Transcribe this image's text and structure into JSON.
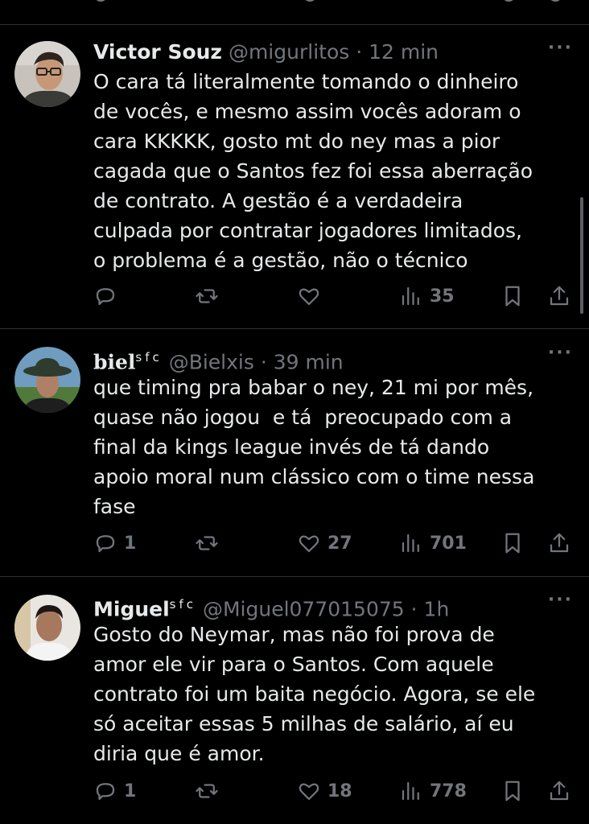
{
  "tweets": [
    {
      "name": "Victor Souz",
      "name_suffix": "",
      "handle": "@migurlitos",
      "dot": "·",
      "time": "12 min",
      "more": "···",
      "text": "O cara tá literalmente tomando o dinheiro\nde vocês, e mesmo assim vocês adoram o\ncara KKKKK, gosto mt do ney mas a pior\ncagada que o Santos fez foi essa aberração\nde contrato. A gestão é a verdadeira\nculpada por contratar jogadores limitados,\no problema é a gestão, não o técnico",
      "replies": "",
      "retweets": "",
      "likes": "",
      "views": "35"
    },
    {
      "name": "biel",
      "name_suffix": "sfc",
      "handle": "@Bielxis",
      "dot": "·",
      "time": "39 min",
      "more": "···",
      "text": "que timing pra babar o ney, 21 mi por mês,\nquase não jogou  e tá  preocupado com a\nfinal da kings league invés de tá dando\napoio moral num clássico com o time nessa\nfase",
      "replies": "1",
      "retweets": "",
      "likes": "27",
      "views": "701"
    },
    {
      "name": "Miguel",
      "name_suffix": "sfc",
      "handle": "@Miguel077015075",
      "dot": "·",
      "time": "1h",
      "more": "···",
      "text": "Gosto do Neymar, mas não foi prova de\namor ele vir para o Santos. Com aquele\ncontrato foi um baita negócio. Agora, se ele\nsó aceitar essas 5 milhas de salário, aí eu\ndiria que é amor.",
      "replies": "1",
      "retweets": "",
      "likes": "18",
      "views": "778"
    }
  ],
  "icons": {
    "reply": "reply-icon",
    "retweet": "retweet-icon",
    "like": "like-icon",
    "views": "views-icon",
    "bookmark": "bookmark-icon",
    "share": "share-icon"
  },
  "colors": {
    "background": "#000000",
    "text": "#e7e9ea",
    "muted": "#71767b",
    "divider": "#2f3336"
  }
}
